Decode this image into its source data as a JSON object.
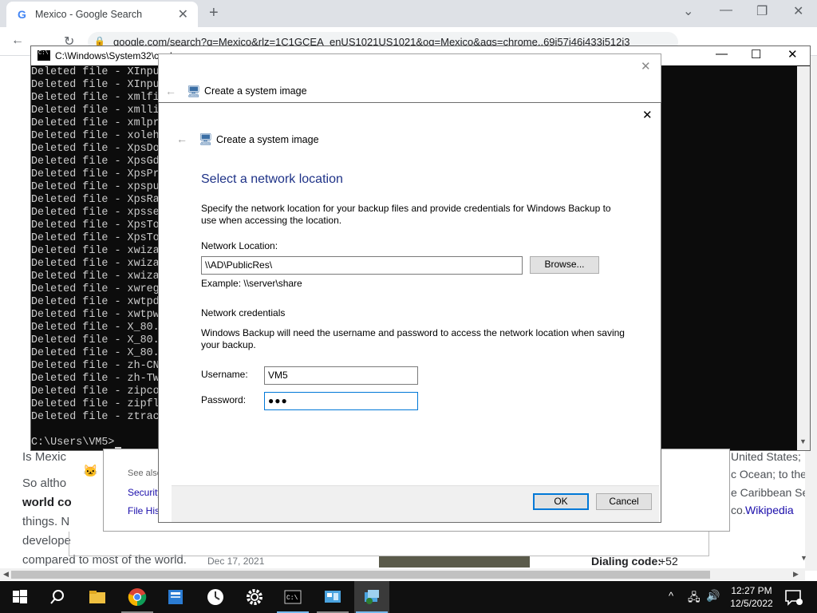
{
  "chrome": {
    "tab_title": "Mexico - Google Search",
    "url": "google.com/search?q=Mexico&rlz=1C1GCEA_enUS1021US1021&oq=Mexico&aqs=chrome..69i57j46i433i512i3"
  },
  "google_bg": {
    "snippet_is_mexico": "Is Mexic",
    "snippet_so_although": "So altho",
    "snippet_world": "world co",
    "snippet_things": "things. N",
    "snippet_develop": "develope",
    "snippet_compared": "compared to most of the world.",
    "snippet_date": "Dec 17, 2021",
    "right_united_states": "United States;",
    "right_ocean": "c Ocean; to the",
    "right_caribbean": "e Caribbean Se",
    "right_wikipedia_prefix": "co.",
    "right_wikipedia": "Wikipedia",
    "dialing_code_label": "Dialing code:",
    "dialing_code_value": "+52",
    "see_also": "See also",
    "security_link": "Security",
    "file_history_link": "File Hist"
  },
  "cmd": {
    "title": "C:\\Windows\\System32\\cmd.exe",
    "lines": [
      "Deleted file - XInpu",
      "Deleted file - XInpu",
      "Deleted file - xmlfi",
      "Deleted file - xmlli",
      "Deleted file - xmlpr",
      "Deleted file - xoleh",
      "Deleted file - XpsDo",
      "Deleted file - XpsGd",
      "Deleted file - XpsPr",
      "Deleted file - xpspu",
      "Deleted file - XpsRa",
      "Deleted file - xpsse",
      "Deleted file - XpsTo",
      "Deleted file - XpsTo",
      "Deleted file - xwiza",
      "Deleted file - xwiza",
      "Deleted file - xwiza",
      "Deleted file - xwreg",
      "Deleted file - xwtpd",
      "Deleted file - xwtpw",
      "Deleted file - X_80.",
      "Deleted file - X_80.",
      "Deleted file - X_80.",
      "Deleted file - zh-CN",
      "Deleted file - zh-TW",
      "Deleted file - zipco",
      "Deleted file - zipfl",
      "Deleted file - ztrac"
    ],
    "prompt": "C:\\Users\\VM5>"
  },
  "outer_dialog": {
    "title": "Create a system image"
  },
  "dialog": {
    "title": "Create a system image",
    "heading": "Select a network location",
    "description": "Specify the network location for your backup files and provide credentials for Windows Backup to use when accessing the location.",
    "network_location_label": "Network Location:",
    "network_location_value": "\\\\AD\\PublicRes\\",
    "browse_button": "Browse...",
    "example_text": "Example: \\\\server\\share",
    "credentials_heading": "Network credentials",
    "credentials_description": "Windows Backup will need the username and password to access the network location when saving your backup.",
    "username_label": "Username:",
    "username_value": "VM5",
    "password_label": "Password:",
    "password_value": "●●●",
    "ok_button": "OK",
    "cancel_button": "Cancel"
  },
  "taskbar": {
    "time": "12:27 PM",
    "date": "12/5/2022"
  }
}
